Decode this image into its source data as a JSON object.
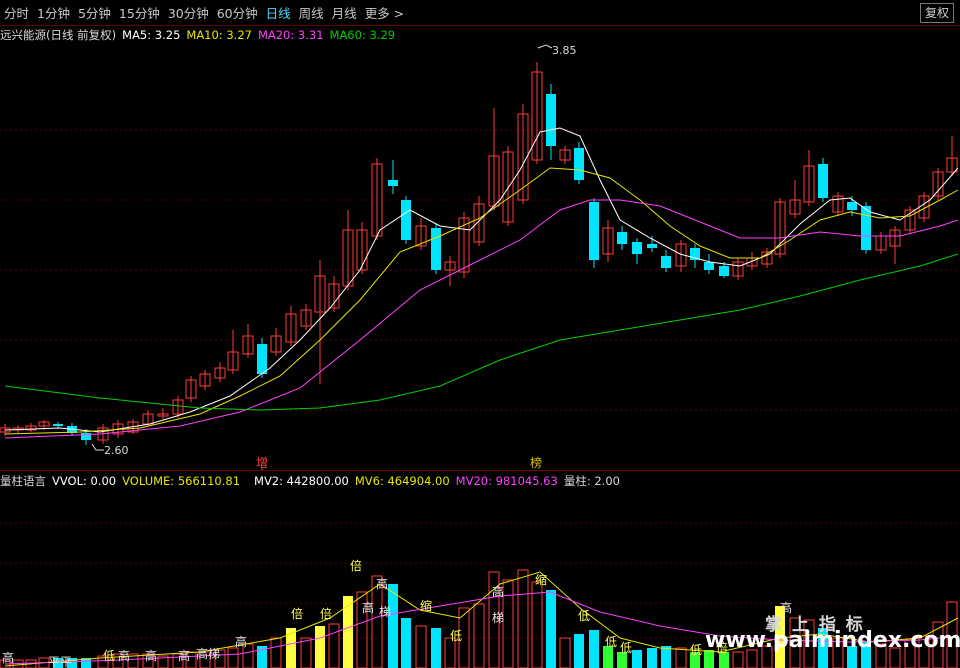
{
  "toolbar": {
    "tabs": [
      "分时",
      "1分钟",
      "5分钟",
      "15分钟",
      "30分钟",
      "60分钟",
      "日线",
      "周线",
      "月线"
    ],
    "active_tab": "日线",
    "more_label": "更多 >",
    "fuquan_label": "复权"
  },
  "price_header": {
    "name": "远兴能源(日线 前复权)",
    "ma5": "MA5: 3.25",
    "ma10": "MA10: 3.27",
    "ma20": "MA20: 3.31",
    "ma60": "MA60: 3.29"
  },
  "price_annotations": {
    "high": "3.85",
    "low": "2.60",
    "marker1": "增",
    "marker2": "榜"
  },
  "volume_header": {
    "name": "量柱语言",
    "vvol": "VVOL: 0.00",
    "volume": "VOLUME: 566110.81",
    "mv2": "MV2: 442800.00",
    "mv6": "MV6: 464904.00",
    "mv20": "MV20: 981045.63",
    "liangzhu": "量柱: 2.00"
  },
  "volume_labels": [
    "高",
    "平",
    "平",
    "低",
    "高",
    "高",
    "高",
    "高",
    "梯",
    "高",
    "倍",
    "倍",
    "倍",
    "高",
    "高",
    "梯",
    "缩",
    "低",
    "梯",
    "高",
    "缩",
    "低",
    "低",
    "低",
    "低",
    "倍",
    "高"
  ],
  "watermark": {
    "line1": "掌 上 指 标",
    "line2": "www.palmindex.com"
  },
  "colors": {
    "up": "#ff3c3c",
    "down": "#00e4ff",
    "ma5": "#ffffff",
    "ma10": "#e6e600",
    "ma20": "#ff40ff",
    "ma60": "#00d000",
    "active_tab": "#4fd6ff"
  }
}
